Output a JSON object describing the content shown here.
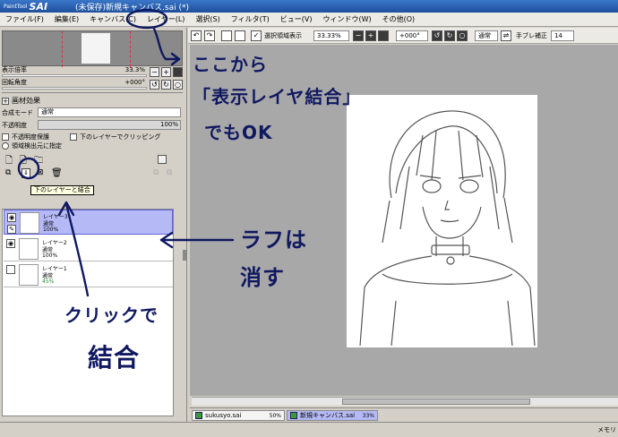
{
  "window": {
    "app_logo_small": "PaintTool",
    "app_logo_big": "SAI",
    "title": "(未保存)新規キャンバス.sai (*)"
  },
  "menu": [
    "ファイル(F)",
    "編集(E)",
    "キャンバス(C)",
    "レイヤー(L)",
    "選択(S)",
    "フィルタ(T)",
    "ビュー(V)",
    "ウィンドウ(W)",
    "その他(O)"
  ],
  "navigator": {
    "zoom_label": "表示倍率",
    "zoom_value": "33.3%",
    "rotation_label": "回転角度",
    "rotation_value": "+000°"
  },
  "texture": {
    "header": "画材効果",
    "blend_label": "合成モード",
    "blend_value": "通常",
    "opacity_label": "不透明度",
    "opacity_value": "100%",
    "protect_label": "不透明度保護",
    "clip_label": "下のレイヤーでクリッピング",
    "source_label": "領域検出元に指定"
  },
  "tooltip": "下のレイヤーと結合",
  "layers": [
    {
      "name": "レイヤー3",
      "mode": "通常",
      "opacity": "100%",
      "visible": true,
      "selected": true
    },
    {
      "name": "レイヤー2",
      "mode": "通常",
      "opacity": "100%",
      "visible": true,
      "selected": false
    },
    {
      "name": "レイヤー1",
      "mode": "通常",
      "opacity": "45%",
      "visible": false,
      "selected": false
    }
  ],
  "canvas_toolbar": {
    "selection_label": "選択領域表示",
    "zoom": "33.33%",
    "rotation": "+000°",
    "mode": "通常",
    "stabilizer_label": "手ブレ補正",
    "stabilizer_value": "14"
  },
  "file_tabs": [
    {
      "name": "sukusyo.sai",
      "zoom": "50%",
      "active": false
    },
    {
      "name": "新規キャンバス.sai",
      "zoom": "33%",
      "active": true
    }
  ],
  "status": {
    "memory": "メモリ"
  },
  "annotations": {
    "note1_line1": "ここから",
    "note1_line2": "「表示レイヤ結合」",
    "note1_line3": "でもOK",
    "note2_line1": "ラフは",
    "note2_line2": "消す",
    "note3_line1": "クリックで",
    "note3_line2": "結合"
  },
  "colors": {
    "titlebar": "#1e4f9c",
    "selected_layer": "#b5b9f5",
    "annotation_ink": "#101860",
    "canvas_bg": "#a8a8a8"
  }
}
